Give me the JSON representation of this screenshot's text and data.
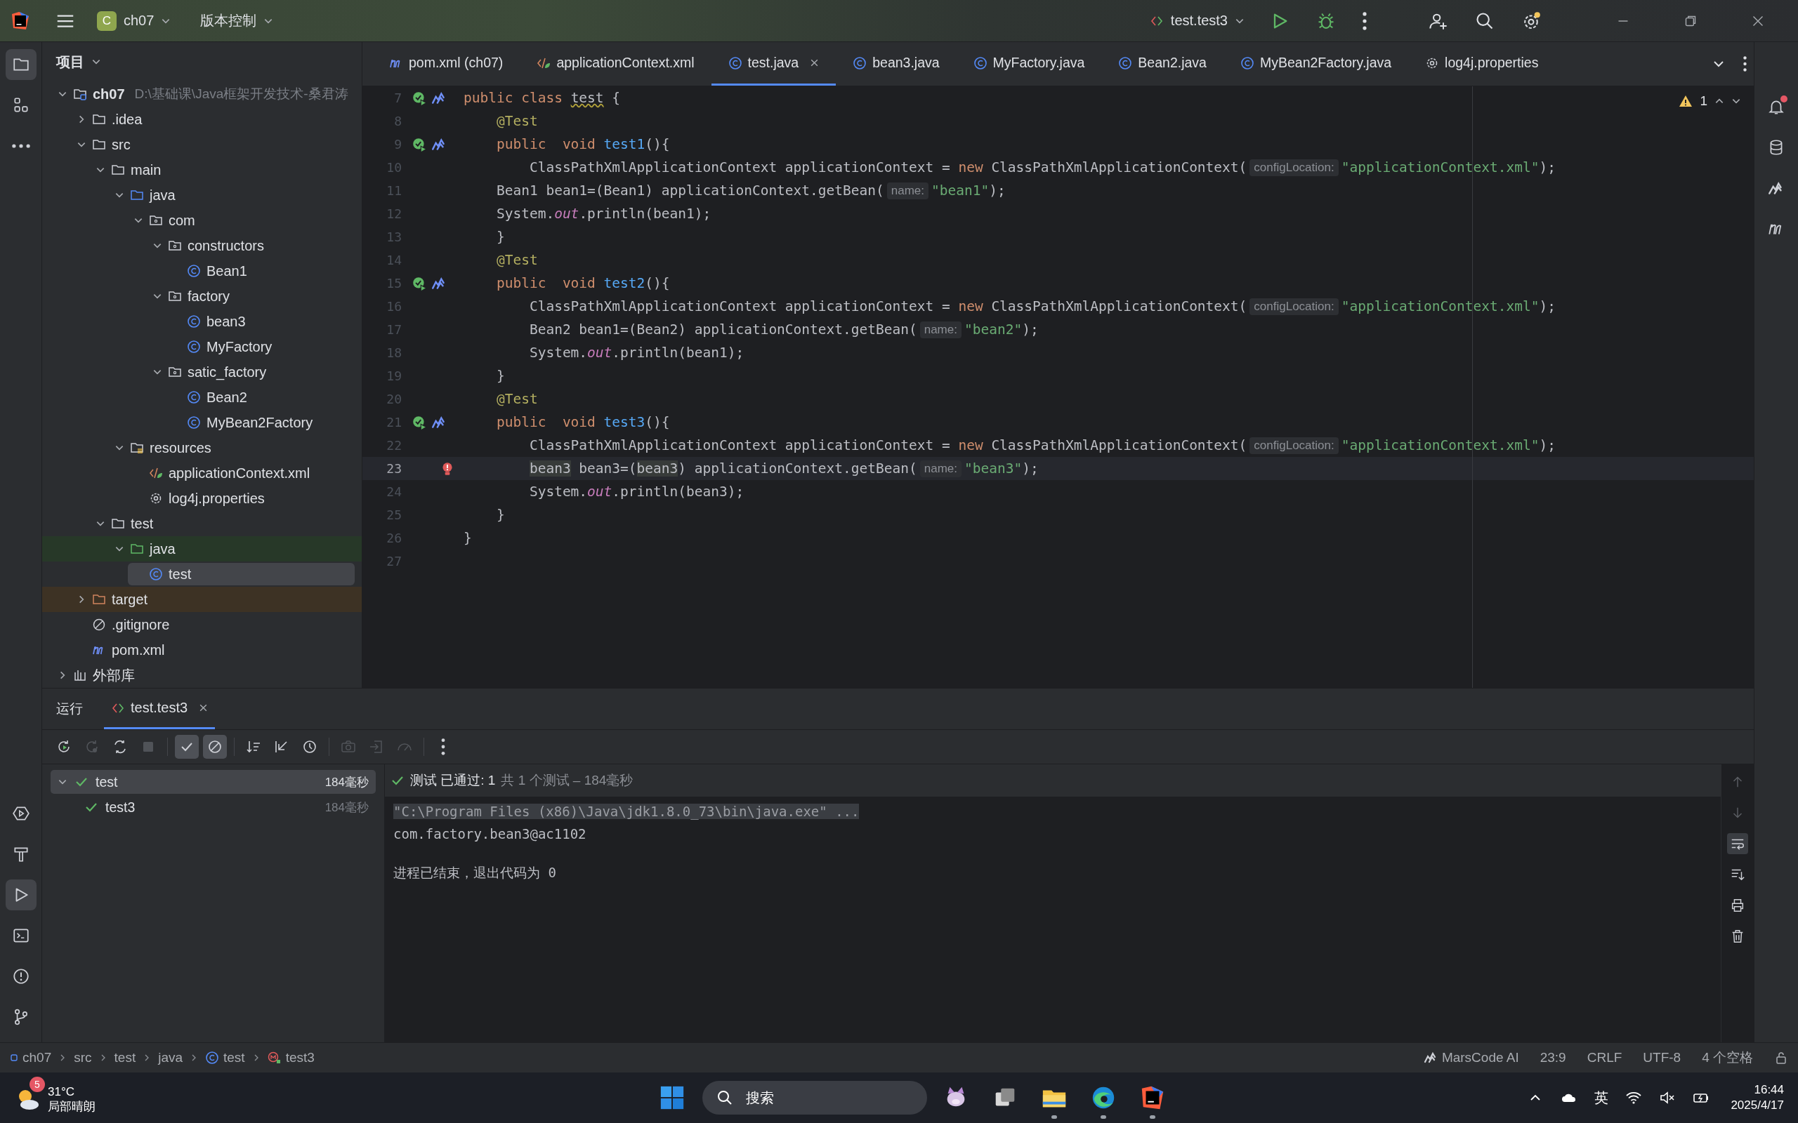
{
  "title_bar": {
    "project_badge": "C",
    "project": "ch07",
    "vcs": "版本控制",
    "run_config": "test.test3",
    "settings_update": true
  },
  "tool_strip_top": [
    {
      "kind": "project",
      "selected": true
    },
    {
      "kind": "structure",
      "selected": false
    },
    {
      "kind": "more",
      "selected": false
    }
  ],
  "tool_strip_bottom": [
    {
      "kind": "services",
      "selected": false
    },
    {
      "kind": "build",
      "selected": false
    },
    {
      "kind": "run",
      "selected": true
    },
    {
      "kind": "terminal",
      "selected": false
    },
    {
      "kind": "problems",
      "selected": false
    },
    {
      "kind": "git",
      "selected": false
    }
  ],
  "right_strip": [
    {
      "kind": "notifications",
      "unread": true
    },
    {
      "kind": "database",
      "unread": false
    },
    {
      "kind": "marscode",
      "unread": false
    },
    {
      "kind": "maven",
      "unread": false
    }
  ],
  "project_panel": {
    "title": "项目",
    "tree": [
      {
        "label": "ch07",
        "path": "D:\\基础课\\Java框架开发技术-桑君涛",
        "kind": "module",
        "expanded": true,
        "selected": false,
        "children": [
          {
            "label": ".idea",
            "kind": "folder",
            "expanded": false,
            "selected": false
          },
          {
            "label": "src",
            "kind": "folder",
            "expanded": true,
            "selected": false,
            "children": [
              {
                "label": "main",
                "kind": "folder",
                "expanded": true,
                "selected": false,
                "children": [
                  {
                    "label": "java",
                    "kind": "source-folder",
                    "expanded": true,
                    "selected": false,
                    "children": [
                      {
                        "label": "com",
                        "kind": "package",
                        "expanded": true,
                        "selected": false,
                        "children": [
                          {
                            "label": "constructors",
                            "kind": "package",
                            "expanded": true,
                            "selected": false,
                            "children": [
                              {
                                "label": "Bean1",
                                "kind": "class",
                                "selected": false
                              }
                            ]
                          },
                          {
                            "label": "factory",
                            "kind": "package",
                            "expanded": true,
                            "selected": false,
                            "children": [
                              {
                                "label": "bean3",
                                "kind": "class",
                                "selected": false
                              },
                              {
                                "label": "MyFactory",
                                "kind": "class",
                                "selected": false
                              }
                            ]
                          },
                          {
                            "label": "satic_factory",
                            "kind": "package",
                            "expanded": true,
                            "selected": false,
                            "children": [
                              {
                                "label": "Bean2",
                                "kind": "class",
                                "selected": false
                              },
                              {
                                "label": "MyBean2Factory",
                                "kind": "class",
                                "selected": false
                              }
                            ]
                          }
                        ]
                      }
                    ]
                  },
                  {
                    "label": "resources",
                    "kind": "resources",
                    "expanded": true,
                    "selected": false,
                    "children": [
                      {
                        "label": "applicationContext.xml",
                        "kind": "xml",
                        "selected": false
                      },
                      {
                        "label": "log4j.properties",
                        "kind": "properties",
                        "selected": false
                      }
                    ]
                  }
                ]
              },
              {
                "label": "test",
                "kind": "folder",
                "expanded": true,
                "selected": false,
                "children": [
                  {
                    "label": "java",
                    "kind": "test-folder",
                    "expanded": true,
                    "selected": false,
                    "children": [
                      {
                        "label": "test",
                        "kind": "class",
                        "selected": true
                      }
                    ]
                  }
                ]
              }
            ]
          },
          {
            "label": "target",
            "kind": "excluded-folder",
            "expanded": false,
            "selected": false
          },
          {
            "label": ".gitignore",
            "kind": "ignore",
            "selected": false
          },
          {
            "label": "pom.xml",
            "kind": "maven",
            "selected": false
          }
        ]
      },
      {
        "label": "外部库",
        "kind": "library",
        "expanded": false,
        "selected": false
      }
    ]
  },
  "editor_tabs": [
    {
      "label": "pom.xml (ch07)",
      "kind": "maven",
      "selected": false
    },
    {
      "label": "applicationContext.xml",
      "kind": "xml",
      "selected": false
    },
    {
      "label": "test.java",
      "kind": "class",
      "selected": true
    },
    {
      "label": "bean3.java",
      "kind": "class",
      "selected": false
    },
    {
      "label": "MyFactory.java",
      "kind": "class",
      "selected": false
    },
    {
      "label": "Bean2.java",
      "kind": "class",
      "selected": false
    },
    {
      "label": "MyBean2Factory.java",
      "kind": "class",
      "selected": false
    },
    {
      "label": "log4j.properties",
      "kind": "properties",
      "selected": false
    }
  ],
  "inspections": {
    "warnings": "1"
  },
  "code_lines": [
    {
      "number": "7",
      "kind": "test-class",
      "current": false,
      "tokens": [
        {
          "kind": "kw",
          "text": "public class "
        },
        {
          "kind": "warn",
          "text": "test"
        },
        {
          "kind": "plain",
          "text": " {"
        }
      ]
    },
    {
      "number": "8",
      "kind": "plain",
      "current": false,
      "tokens": [
        {
          "kind": "ann",
          "text": "    @Test"
        }
      ]
    },
    {
      "number": "9",
      "kind": "test-method",
      "current": false,
      "tokens": [
        {
          "kind": "kw",
          "text": "    public  void "
        },
        {
          "kind": "fn",
          "text": "test1"
        },
        {
          "kind": "plain",
          "text": "(){"
        }
      ]
    },
    {
      "number": "10",
      "kind": "plain",
      "current": false,
      "tokens": [
        {
          "kind": "plain",
          "text": "        ClassPathXmlApplicationContext applicationContext = "
        },
        {
          "kind": "kw",
          "text": "new "
        },
        {
          "kind": "plain",
          "text": "ClassPathXmlApplicationContext("
        },
        {
          "kind": "hint",
          "text": "configLocation:"
        },
        {
          "kind": "str",
          "text": "\"applicationContext.xml\""
        },
        {
          "kind": "plain",
          "text": ");"
        }
      ]
    },
    {
      "number": "11",
      "kind": "plain",
      "current": false,
      "tokens": [
        {
          "kind": "plain",
          "text": "    Bean1 bean1=(Bean1) applicationContext.getBean("
        },
        {
          "kind": "hint",
          "text": "name:"
        },
        {
          "kind": "str",
          "text": "\"bean1\""
        },
        {
          "kind": "plain",
          "text": ");"
        }
      ]
    },
    {
      "number": "12",
      "kind": "plain",
      "current": false,
      "tokens": [
        {
          "kind": "plain",
          "text": "    System."
        },
        {
          "kind": "field",
          "text": "out"
        },
        {
          "kind": "plain",
          "text": ".println(bean1);"
        }
      ]
    },
    {
      "number": "13",
      "kind": "plain",
      "current": false,
      "tokens": [
        {
          "kind": "plain",
          "text": "    }"
        }
      ]
    },
    {
      "number": "14",
      "kind": "plain",
      "current": false,
      "tokens": [
        {
          "kind": "ann",
          "text": "    @Test"
        }
      ]
    },
    {
      "number": "15",
      "kind": "test-method",
      "current": false,
      "tokens": [
        {
          "kind": "kw",
          "text": "    public  void "
        },
        {
          "kind": "fn",
          "text": "test2"
        },
        {
          "kind": "plain",
          "text": "(){"
        }
      ]
    },
    {
      "number": "16",
      "kind": "plain",
      "current": false,
      "tokens": [
        {
          "kind": "plain",
          "text": "        ClassPathXmlApplicationContext applicationContext = "
        },
        {
          "kind": "kw",
          "text": "new "
        },
        {
          "kind": "plain",
          "text": "ClassPathXmlApplicationContext("
        },
        {
          "kind": "hint",
          "text": "configLocation:"
        },
        {
          "kind": "str",
          "text": "\"applicationContext.xml\""
        },
        {
          "kind": "plain",
          "text": ");"
        }
      ]
    },
    {
      "number": "17",
      "kind": "plain",
      "current": false,
      "tokens": [
        {
          "kind": "plain",
          "text": "        Bean2 bean1=(Bean2) applicationContext.getBean("
        },
        {
          "kind": "hint",
          "text": "name:"
        },
        {
          "kind": "str",
          "text": "\"bean2\""
        },
        {
          "kind": "plain",
          "text": ");"
        }
      ]
    },
    {
      "number": "18",
      "kind": "plain",
      "current": false,
      "tokens": [
        {
          "kind": "plain",
          "text": "        System."
        },
        {
          "kind": "field",
          "text": "out"
        },
        {
          "kind": "plain",
          "text": ".println(bean1);"
        }
      ]
    },
    {
      "number": "19",
      "kind": "plain",
      "current": false,
      "tokens": [
        {
          "kind": "plain",
          "text": "    }"
        }
      ]
    },
    {
      "number": "20",
      "kind": "plain",
      "current": false,
      "tokens": [
        {
          "kind": "ann",
          "text": "    @Test"
        }
      ]
    },
    {
      "number": "21",
      "kind": "test-method",
      "current": false,
      "tokens": [
        {
          "kind": "kw",
          "text": "    public  void "
        },
        {
          "kind": "fn",
          "text": "test3"
        },
        {
          "kind": "plain",
          "text": "(){"
        }
      ]
    },
    {
      "number": "22",
      "kind": "plain",
      "current": false,
      "tokens": [
        {
          "kind": "plain",
          "text": "        ClassPathXmlApplicationContext applicationContext = "
        },
        {
          "kind": "kw",
          "text": "new "
        },
        {
          "kind": "plain",
          "text": "ClassPathXmlApplicationContext("
        },
        {
          "kind": "hint",
          "text": "configLocation:"
        },
        {
          "kind": "str",
          "text": "\"applicationContext.xml\""
        },
        {
          "kind": "plain",
          "text": ");"
        }
      ]
    },
    {
      "number": "23",
      "kind": "error",
      "current": true,
      "tokens": [
        {
          "kind": "ref",
          "text": "        bean3"
        },
        {
          "kind": "plain",
          "text": " bean3=("
        },
        {
          "kind": "ref",
          "text": "bean3"
        },
        {
          "kind": "plain",
          "text": ") applicationContext.getBean("
        },
        {
          "kind": "hint",
          "text": "name:"
        },
        {
          "kind": "str",
          "text": "\"bean3\""
        },
        {
          "kind": "plain",
          "text": ");"
        }
      ]
    },
    {
      "number": "24",
      "kind": "plain",
      "current": false,
      "tokens": [
        {
          "kind": "plain",
          "text": "        System."
        },
        {
          "kind": "field",
          "text": "out"
        },
        {
          "kind": "plain",
          "text": ".println(bean3);"
        }
      ]
    },
    {
      "number": "25",
      "kind": "plain",
      "current": false,
      "tokens": [
        {
          "kind": "plain",
          "text": "    }"
        }
      ]
    },
    {
      "number": "26",
      "kind": "plain",
      "current": false,
      "tokens": [
        {
          "kind": "plain",
          "text": "}"
        }
      ]
    },
    {
      "number": "27",
      "kind": "plain",
      "current": false
    }
  ],
  "run_panel": {
    "title": "运行",
    "tabs": [
      {
        "label": "test.test3",
        "selected": true
      }
    ],
    "toolbar": [
      {
        "kind": "rerun",
        "disabled": false
      },
      {
        "kind": "rerun-failed",
        "disabled": true
      },
      {
        "kind": "toggle-auto",
        "disabled": false
      },
      {
        "kind": "stop",
        "disabled": true
      },
      {
        "kind": "show-passed",
        "disabled": false,
        "on": true
      },
      {
        "kind": "show-ignored",
        "disabled": false,
        "on": true
      },
      {
        "kind": "sort",
        "disabled": false
      },
      {
        "kind": "collapse",
        "disabled": false
      },
      {
        "kind": "history",
        "disabled": false
      },
      {
        "kind": "snapshot",
        "disabled": true
      },
      {
        "kind": "import",
        "disabled": true
      },
      {
        "kind": "gauge",
        "disabled": true
      },
      {
        "kind": "more",
        "disabled": false
      }
    ],
    "tests": [
      {
        "label": "test",
        "time": "184毫秒",
        "passed": true,
        "expanded": true,
        "selected": true,
        "children": [
          {
            "label": "test3",
            "time": "184毫秒",
            "passed": true,
            "selected": false
          }
        ]
      }
    ],
    "result": {
      "passed": true,
      "label": "测试 已通过: 1",
      "summary": "共 1 个测试 – 184毫秒"
    },
    "console": [
      {
        "kind": "command",
        "text": "\"C:\\Program Files (x86)\\Java\\jdk1.8.0_73\\bin\\java.exe\" ..."
      },
      {
        "kind": "output",
        "text": "com.factory.bean3@ac1102"
      },
      {
        "kind": "exit",
        "text": "进程已结束，退出代码为 0"
      }
    ]
  },
  "status_bar": {
    "breadcrumbs": [
      {
        "label": "ch07",
        "kind": "module"
      },
      {
        "label": "src"
      },
      {
        "label": "test"
      },
      {
        "label": "java"
      },
      {
        "label": "test",
        "kind": "class"
      },
      {
        "label": "test3",
        "kind": "method"
      }
    ],
    "assistant": "MarsCode AI",
    "position": "23:9",
    "line_ending": "CRLF",
    "encoding": "UTF-8",
    "indent": "4 个空格"
  },
  "taskbar": {
    "weather_badge": "5",
    "temperature": "31°C",
    "weather": "局部晴朗",
    "search": "搜索",
    "apps": [
      {
        "kind": "mascot",
        "running": false
      },
      {
        "kind": "task-view",
        "running": false
      },
      {
        "kind": "explorer",
        "running": true
      },
      {
        "kind": "edge",
        "running": true
      },
      {
        "kind": "intellij",
        "running": true
      }
    ],
    "language": "英",
    "time": "16:44",
    "date": "2025/4/17"
  }
}
